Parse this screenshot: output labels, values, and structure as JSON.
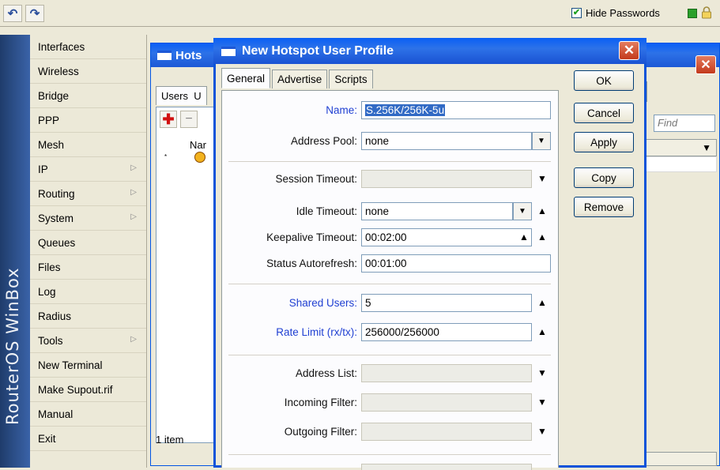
{
  "toolbar": {
    "undo_icon": "undo-icon",
    "redo_icon": "redo-icon",
    "hide_passwords_label": "Hide Passwords",
    "hide_passwords_checked": true,
    "status_color": "#2aa02a"
  },
  "rail": {
    "brand": "RouterOS WinBox"
  },
  "menu": {
    "items": [
      {
        "label": "Interfaces",
        "submenu": false
      },
      {
        "label": "Wireless",
        "submenu": false
      },
      {
        "label": "Bridge",
        "submenu": false
      },
      {
        "label": "PPP",
        "submenu": false
      },
      {
        "label": "Mesh",
        "submenu": false
      },
      {
        "label": "IP",
        "submenu": true
      },
      {
        "label": "Routing",
        "submenu": true
      },
      {
        "label": "System",
        "submenu": true
      },
      {
        "label": "Queues",
        "submenu": false
      },
      {
        "label": "Files",
        "submenu": false
      },
      {
        "label": "Log",
        "submenu": false
      },
      {
        "label": "Radius",
        "submenu": false
      },
      {
        "label": "Tools",
        "submenu": true
      },
      {
        "label": "New Terminal",
        "submenu": false
      },
      {
        "label": "Make Supout.rif",
        "submenu": false
      },
      {
        "label": "Manual",
        "submenu": false
      },
      {
        "label": "Exit",
        "submenu": false
      }
    ]
  },
  "bg_window": {
    "title": "Hots",
    "tab_users": "Users",
    "tab_next": "U",
    "column_name": "Nar",
    "row_flag": "*",
    "count": "1 item",
    "find_placeholder": "Find"
  },
  "dialog": {
    "title": "New Hotspot User Profile",
    "tabs": [
      {
        "label": "General",
        "active": true
      },
      {
        "label": "Advertise",
        "active": false
      },
      {
        "label": "Scripts",
        "active": false
      }
    ],
    "fields": {
      "name": {
        "label": "Name:",
        "value": "S.256K/256K-5u"
      },
      "address_pool": {
        "label": "Address Pool:",
        "value": "none"
      },
      "session_timeout": {
        "label": "Session Timeout:",
        "value": ""
      },
      "idle_timeout": {
        "label": "Idle Timeout:",
        "value": "none"
      },
      "keepalive_timeout": {
        "label": "Keepalive Timeout:",
        "value": "00:02:00"
      },
      "status_autorefresh": {
        "label": "Status Autorefresh:",
        "value": "00:01:00"
      },
      "shared_users": {
        "label": "Shared Users:",
        "value": "5"
      },
      "rate_limit": {
        "label": "Rate Limit (rx/tx):",
        "value": "256000/256000"
      },
      "address_list": {
        "label": "Address List:",
        "value": ""
      },
      "incoming_filter": {
        "label": "Incoming Filter:",
        "value": ""
      },
      "outgoing_filter": {
        "label": "Outgoing Filter:",
        "value": ""
      }
    },
    "buttons": {
      "ok": "OK",
      "cancel": "Cancel",
      "apply": "Apply",
      "copy": "Copy",
      "remove": "Remove"
    }
  },
  "colors": {
    "titlebar": "#0a5ff6",
    "close": "#c3391b",
    "label_blue": "#1f3fd2",
    "selection": "#316ac5"
  }
}
